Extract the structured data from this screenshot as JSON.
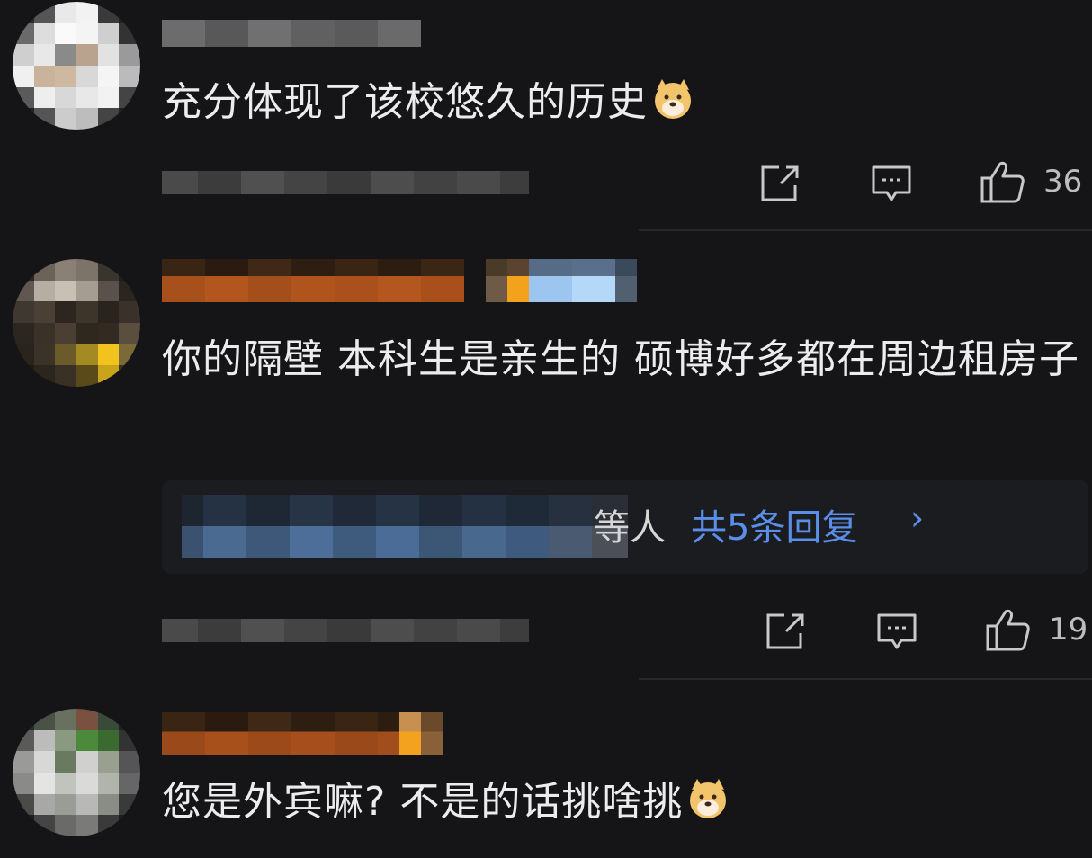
{
  "comments": [
    {
      "text": "充分体现了该校悠久的历史",
      "emoji": "doge-emoji",
      "like_count": "36"
    },
    {
      "text": "你的隔壁 本科生是亲生的 硕博好多都在周边租房子",
      "replies": {
        "who": "等人",
        "count_label": "共5条回复",
        "chevron": "›"
      },
      "like_count": "19"
    },
    {
      "text": "您是外宾嘛? 不是的话挑啥挑",
      "emoji": "doge-emoji"
    }
  ],
  "colors": {
    "background": "#151518",
    "text": "#ececec",
    "link": "#5a8ee8",
    "icon": "#c8c8c8"
  },
  "icons": [
    "share-icon",
    "comment-icon",
    "thumbs-up-icon",
    "doge-emoji"
  ]
}
